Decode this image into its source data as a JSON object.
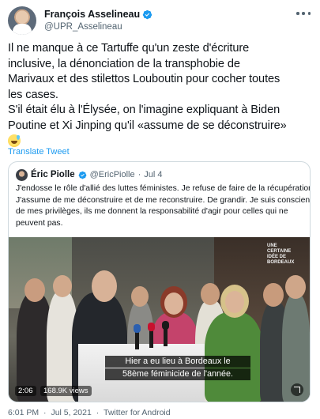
{
  "author": {
    "display_name": "François Asselineau",
    "handle": "@UPR_Asselineau"
  },
  "tweet": {
    "lines": [
      "Il ne manque à ce Tartuffe qu'un zeste d'écriture",
      "inclusive, la dénonciation de la transphobie de",
      "Marivaux et des stilettos Louboutin pour cocher toutes",
      "les cases.",
      "S'il était élu à l'Élysée, on l'imagine expliquant à Biden",
      "Poutine et Xi Jinping qu'il «assume de se déconstruire»"
    ],
    "emoji_icon": "grinning-sweat-emoji",
    "translate_label": "Translate Tweet"
  },
  "quote": {
    "display_name": "Éric Piolle",
    "handle": "@EricPiolle",
    "separator": "·",
    "date": "Jul 4",
    "lines": [
      "J'endosse le rôle d'allié des luttes féministes. Je refuse de faire de la récupération.",
      "J'assume de me déconstruire et de me reconstruire. De grandir. Je suis conscient",
      "de mes privilèges, ils me donnent la responsabilité d'agir pour celles qui ne",
      "peuvent pas."
    ],
    "video": {
      "watermark": "UNE CERTAINE IDÉE DE BORDEAUX",
      "subtitle_line1": "Hier a eu lieu à Bordeaux le",
      "subtitle_line2": "58ème féminicide de l'année.",
      "duration": "2:06",
      "views": "168.9K views"
    }
  },
  "meta": {
    "time": "6:01 PM",
    "sep1": "·",
    "date": "Jul 5, 2021",
    "sep2": "·",
    "source": "Twitter for Android"
  },
  "colors": {
    "verified": "#1d9bf0",
    "link": "#1d9bf0",
    "secondary_text": "#536471"
  }
}
